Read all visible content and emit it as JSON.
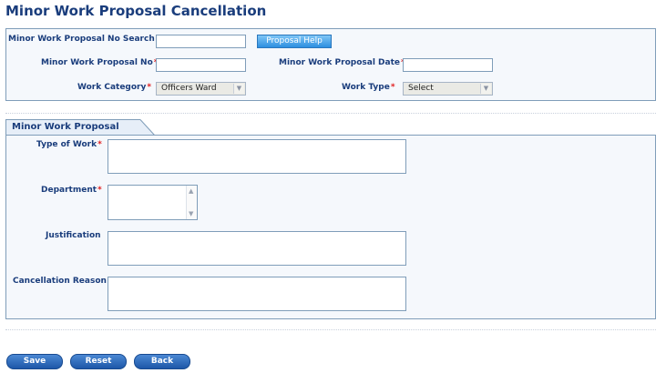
{
  "page": {
    "title": "Minor Work Proposal Cancellation"
  },
  "search_panel": {
    "search_label": "Minor Work Proposal No Search",
    "search_value": "",
    "help_button": "Proposal Help",
    "proposal_no_label": "Minor Work Proposal No",
    "proposal_no_value": "",
    "proposal_date_label": "Minor Work Proposal Date",
    "proposal_date_value": "",
    "work_category_label": "Work Category",
    "work_category_value": "Officers Ward",
    "work_type_label": "Work Type",
    "work_type_value": "Select",
    "required_marker": "*"
  },
  "proposal_section": {
    "tab_label": "Minor Work Proposal",
    "type_of_work_label": "Type of Work",
    "department_label": "Department",
    "justification_label": "Justification",
    "cancellation_reason_label": "Cancellation Reason"
  },
  "actions": {
    "save": "Save",
    "reset": "Reset",
    "back": "Back"
  },
  "colors": {
    "label": "#1a3d7c",
    "required": "#e11d1d",
    "button": "#1d57a8",
    "help_button": "#2d8fe0",
    "border": "#7f9db9"
  }
}
